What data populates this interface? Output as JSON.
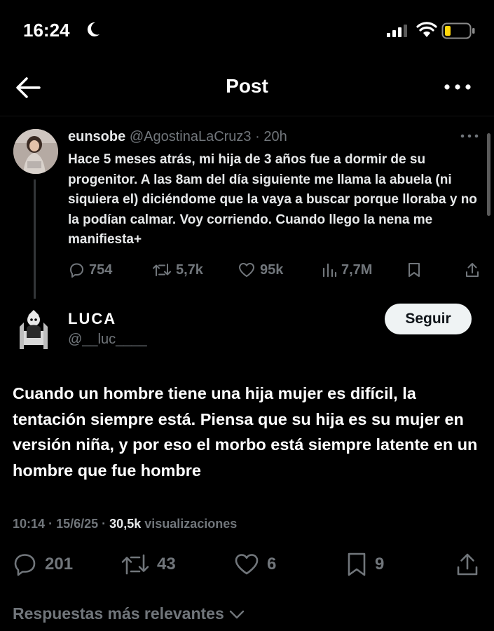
{
  "status_bar": {
    "time": "16:24"
  },
  "nav": {
    "title": "Post"
  },
  "parent_post": {
    "display_name": "eunsobe",
    "handle": "@AgostinaLaCruz3",
    "separator": "·",
    "time_ago": "20h",
    "text": "Hace 5 meses atrás, mi hija de 3 años fue a dormir de su progenitor. A las 8am del día siguiente me llama la abuela (ni siquiera el) diciéndome que la vaya a buscar porque lloraba y no la podían calmar. Voy corriendo. Cuando llego la nena me manifiesta+",
    "replies": "754",
    "reposts": "5,7k",
    "likes": "95k",
    "views": "7,7M"
  },
  "author": {
    "display_name": "LUCA",
    "handle": "@__luc____",
    "follow_label": "Seguir"
  },
  "post": {
    "text": "Cuando un hombre tiene una hija mujer es difícil, la tentación siempre está. Piensa que su hija es su mujer en versión niña, y por eso el morbo está siempre latente en un hombre que fue hombre",
    "time": "10:14",
    "date": "15/6/25",
    "separator": "·",
    "views_count": "30,5k",
    "views_label": "visualizaciones",
    "replies": "201",
    "reposts": "43",
    "likes": "6",
    "bookmarks": "9"
  },
  "replies_sort": {
    "label": "Respuestas más relevantes"
  },
  "icons": {
    "back": "arrow-left-icon",
    "more": "more-horizontal-icon",
    "reply": "reply-icon",
    "repost": "repost-icon",
    "like": "heart-icon",
    "views": "views-bar-icon",
    "bookmark": "bookmark-icon",
    "share": "share-icon",
    "chevron": "chevron-down-icon"
  },
  "colors": {
    "background": "#000000",
    "text": "#e7e9ea",
    "muted": "#71767b",
    "follow_bg": "#eff3f4",
    "battery": "#ffd60a"
  }
}
